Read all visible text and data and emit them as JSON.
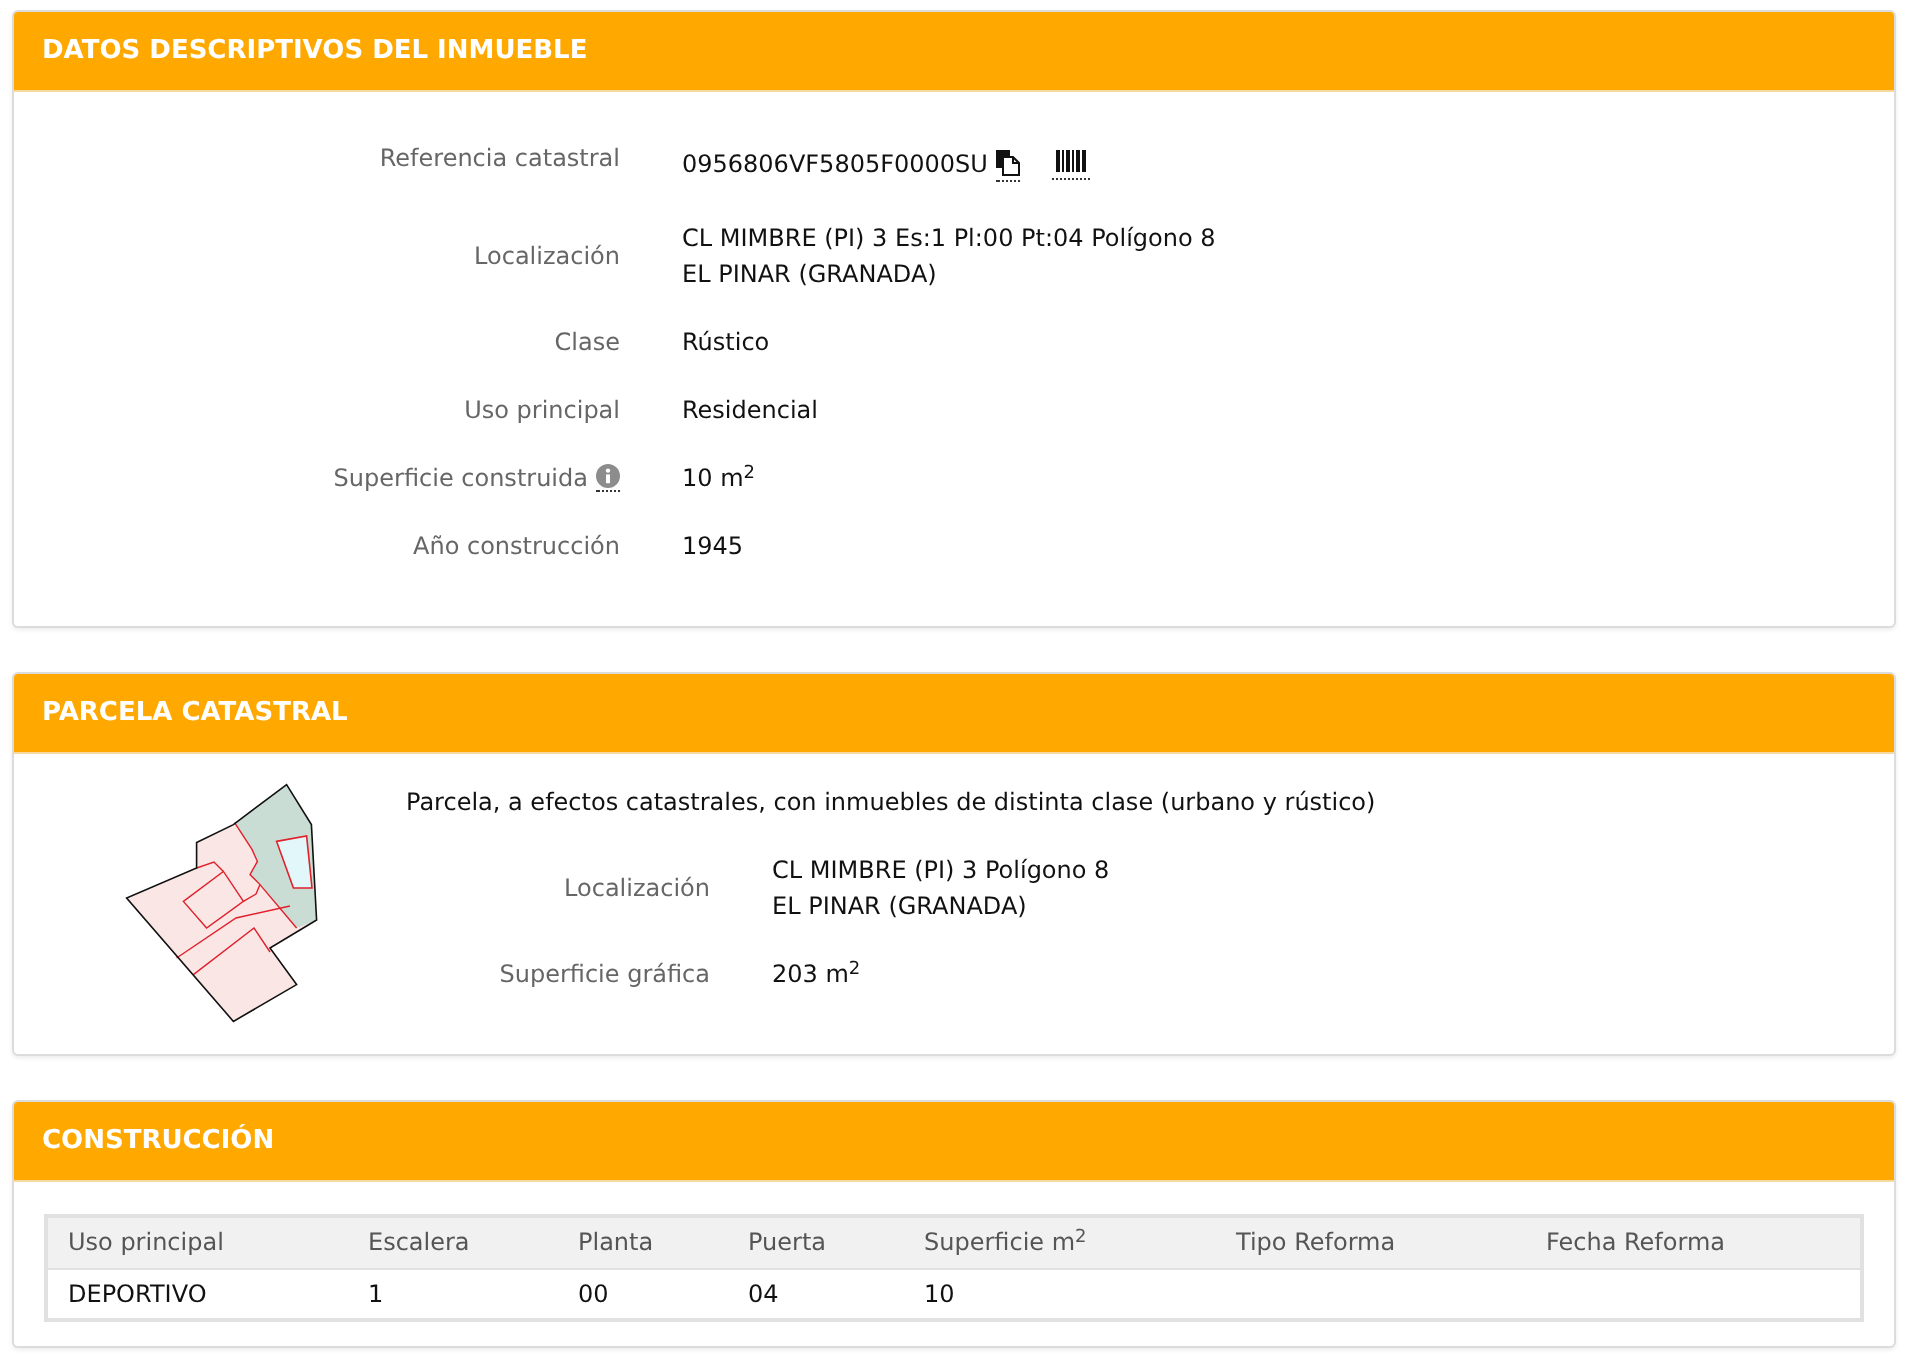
{
  "property_details": {
    "title": "DATOS DESCRIPTIVOS DEL INMUEBLE",
    "fields": [
      {
        "kind": "reference",
        "label": "Referencia catastral",
        "value": [
          "0956806VF5805F0000SU"
        ]
      },
      {
        "kind": "plain",
        "label": "Localización",
        "value": [
          "CL MIMBRE (PI) 3 Es:1 Pl:00 Pt:04 Polígono 8",
          "EL PINAR (GRANADA)"
        ]
      },
      {
        "kind": "plain",
        "label": "Clase",
        "value": [
          "Rústico"
        ]
      },
      {
        "kind": "plain",
        "label": "Uso principal",
        "value": [
          "Residencial"
        ]
      },
      {
        "kind": "info",
        "label": "Superficie construida",
        "value": [
          "10 m$^{2}$"
        ]
      },
      {
        "kind": "plain",
        "label": "Año construcción",
        "value": [
          "1945"
        ]
      }
    ]
  },
  "parcel": {
    "title": "PARCELA CATASTRAL",
    "note": "Parcela, a efectos catastrales, con inmuebles de distinta clase (urbano y rústico)",
    "fields": [
      {
        "label": "Localización",
        "value": [
          "CL MIMBRE (PI) 3 Polígono 8",
          "EL PINAR (GRANADA)"
        ]
      },
      {
        "label": "Superficie gráfica",
        "value": [
          "203 m$^{2}$"
        ]
      }
    ]
  },
  "construction": {
    "title": "CONSTRUCCIÓN",
    "table": {
      "columns": [
        "Uso principal",
        "Escalera",
        "Planta",
        "Puerta",
        "Superficie m$^{2}$",
        "Tipo Reforma",
        "Fecha Reforma"
      ],
      "rows": [
        [
          "DEPORTIVO",
          "1",
          "00",
          "04",
          "10"
        ]
      ]
    }
  }
}
